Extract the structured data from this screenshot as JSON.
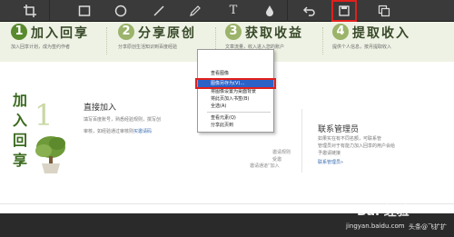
{
  "toolbar": {
    "crop_icon": "crop-icon",
    "rect_icon": "rectangle-icon",
    "ellipse_icon": "ellipse-icon",
    "line_icon": "line-icon",
    "pen_icon": "pen-icon",
    "text_label": "T",
    "blur_icon": "blur-drop-icon",
    "undo_icon": "undo-icon",
    "save_icon": "save-icon",
    "copy_icon": "copy-icon",
    "highlight_color": "#e0201c"
  },
  "steps": [
    {
      "num": "1",
      "title": "加入回享",
      "desc": "加入回享计划，成为签约作者",
      "color": "#5a8a2e"
    },
    {
      "num": "2",
      "title": "分享原创",
      "desc": "分享原创生活知识到百度经验",
      "color": "#9bb36a"
    },
    {
      "num": "3",
      "title": "获取收益",
      "desc": "文章流量，收入进入您的账户",
      "color": "#9bb36a"
    },
    {
      "num": "4",
      "title": "提取收入",
      "desc": "提供个人信息，按月提取收入",
      "color": "#9bb36a"
    }
  ],
  "side": {
    "label": "加入回享",
    "number": "1"
  },
  "join": {
    "title": "直接加入",
    "desc1": "填写百度账号，熟悉经验规则，撰写创",
    "desc2": "审核，如经验通过审核则",
    "link": "买邀请码"
  },
  "middle": {
    "frag1": "邀请规则",
    "frag2": "受邀",
    "frag3": "邀请通道“加入"
  },
  "contact": {
    "title": "联系管理员",
    "desc1": "如果实在有不同名额，可联系管",
    "desc2": "管理员对于有能力加入回享的用户会给",
    "desc3": "予邀请链接",
    "link": "联系管理员»"
  },
  "context_menu": {
    "items": [
      {
        "label": "查看图像"
      },
      {
        "label": "图像另存为(V)…",
        "selected": true
      },
      {
        "label": "将图像设置为桌面背景"
      },
      {
        "label": "将此页加入书签(B)"
      },
      {
        "label": "全选(A)"
      },
      {
        "label": "查看元素(Q)"
      },
      {
        "label": "分享此页到"
      }
    ]
  },
  "watermark": {
    "logo": "Bai 经验",
    "url": "jingyan.baidu.com",
    "user": "头条@飞扩扩"
  }
}
